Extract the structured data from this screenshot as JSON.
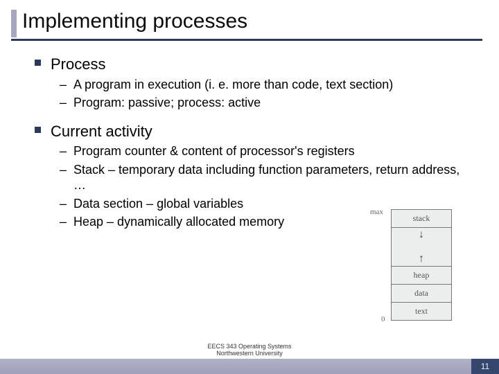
{
  "title": "Implementing processes",
  "bullets": [
    {
      "label": "Process",
      "items": [
        "A program in execution (i. e. more than code, text section)",
        "Program: passive; process: active"
      ]
    },
    {
      "label": "Current activity",
      "items": [
        "Program counter & content of processor's registers",
        "Stack – temporary data including function parameters, return address, …",
        "Data section – global variables",
        "Heap – dynamically allocated memory"
      ]
    }
  ],
  "diagram": {
    "top_label": "max",
    "bottom_label": "0",
    "segments": [
      "stack",
      "heap",
      "data",
      "text"
    ]
  },
  "footer": {
    "line1": "EECS 343 Operating Systems",
    "line2": "Northwestern University",
    "page": "11"
  }
}
